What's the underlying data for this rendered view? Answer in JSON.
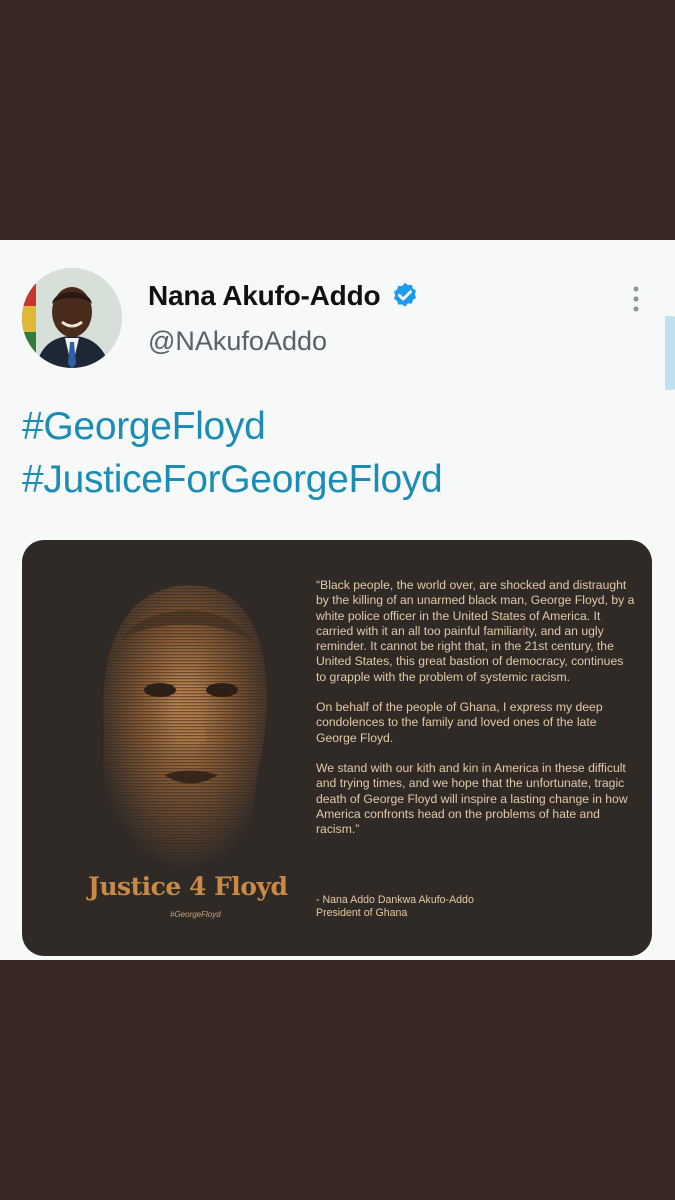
{
  "tweet": {
    "author_name": "Nana Akufo-Addo",
    "handle": "@NAkufoAddo",
    "verified_icon": "verified-badge-icon",
    "more_icon": "more-vertical-icon",
    "hashtags": [
      "#GeorgeFloyd",
      "#JusticeForGeorgeFloyd"
    ]
  },
  "card": {
    "headline": "Justice 4 Floyd",
    "tag": "#GeorgeFloyd",
    "quote_paragraphs": [
      "“Black people, the world over, are shocked and distraught by the killing of an unarmed black man, George Floyd, by a white police officer in the United States of America. It carried with it an all too painful familiarity, and an ugly reminder. It cannot be right that, in the 21st century, the United States, this great bastion of democracy, continues to grapple with the problem of systemic racism.",
      "On behalf of the people of Ghana, I express my deep condolences to the family and loved ones of the late George Floyd.",
      "We stand with our kith and kin in America in these difficult and trying times, and we hope that the unfortunate, tragic death of George Floyd will inspire a lasting change in how America confronts head on the problems of hate and racism.”"
    ],
    "signature_line1": "- Nana Addo Dankwa Akufo-Addo",
    "signature_line2": "President of Ghana"
  },
  "colors": {
    "background": "#3a2826",
    "tweet_bg": "#f7f8f8",
    "hashtag": "#1b8db5",
    "verified": "#1d9bf0",
    "card_bg": "#302a26",
    "card_text": "#e3c9a4",
    "headline": "#c98a45"
  }
}
